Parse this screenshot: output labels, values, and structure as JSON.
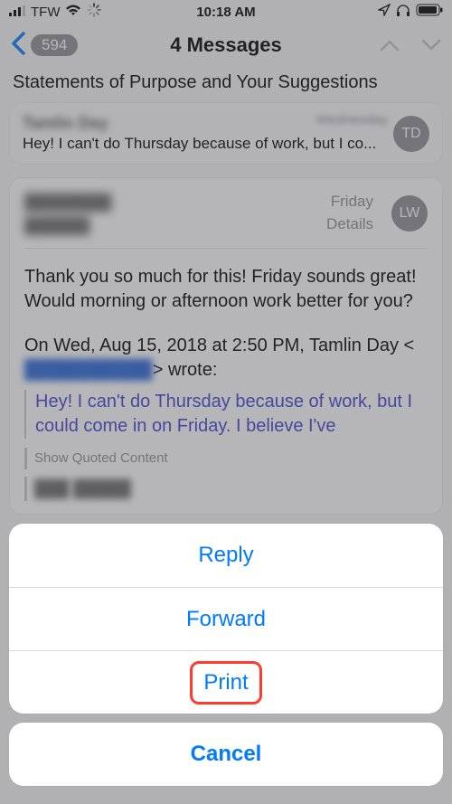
{
  "status": {
    "carrier": "TFW",
    "time": "10:18 AM"
  },
  "nav": {
    "badge": "594",
    "title": "4 Messages",
    "subject": "Statements of Purpose and Your Suggestions"
  },
  "prev": {
    "sender": "Tamlin Day",
    "preview": "Hey! I can't do Thursday because of work, but I co...",
    "day": "Wednesday",
    "initials": "TD"
  },
  "msg": {
    "from_line1": "████████",
    "from_line2": "██████",
    "day": "Friday",
    "details": "Details",
    "initials": "LW",
    "body": "Thank you so much for this! Friday sounds great! Would morning or afternoon work better for you?",
    "reply_intro_pre": "On Wed, Aug 15, 2018 at 2:50 PM, Tamlin Day <",
    "reply_intro_email": "██████████",
    "reply_intro_post": "> wrote:",
    "quote": "Hey! I can't do Thursday because of work, but I could come in on Friday. I believe I've",
    "show_quoted": "Show Quoted Content",
    "sig": "███  █████"
  },
  "sheet": {
    "reply": "Reply",
    "forward": "Forward",
    "print": "Print",
    "cancel": "Cancel"
  }
}
